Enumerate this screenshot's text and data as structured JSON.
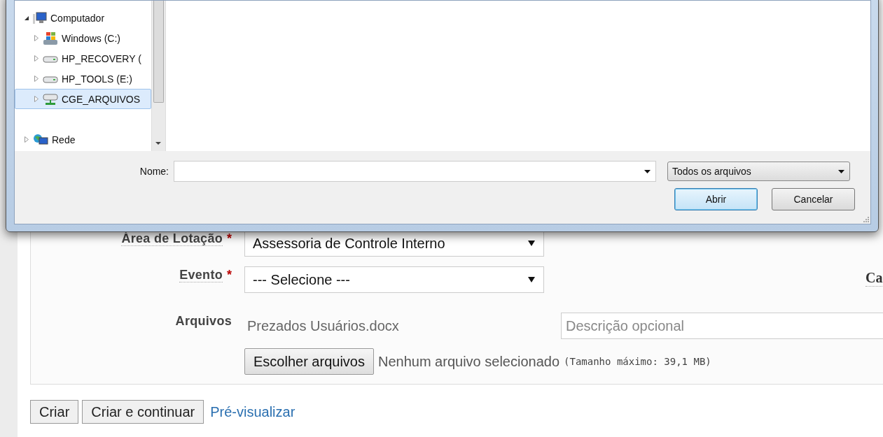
{
  "dialog": {
    "tree": [
      {
        "label": "Computador",
        "kind": "computer",
        "expanded": true,
        "selected": false,
        "children": [
          {
            "label": "Windows (C:)",
            "kind": "system-drive",
            "expanded": false,
            "selected": false
          },
          {
            "label": "HP_RECOVERY (",
            "kind": "drive",
            "expanded": false,
            "selected": false
          },
          {
            "label": "HP_TOOLS (E:)",
            "kind": "drive",
            "expanded": false,
            "selected": false
          },
          {
            "label": "CGE_ARQUIVOS",
            "kind": "network-drive",
            "expanded": false,
            "selected": true
          }
        ]
      },
      {
        "label": "Rede",
        "kind": "network",
        "expanded": false,
        "selected": false
      }
    ],
    "name_label": "Nome:",
    "file_type": "Todos os arquivos",
    "buttons": [
      {
        "label": "Abrir",
        "default": true
      },
      {
        "label": "Cancelar",
        "default": false
      }
    ]
  },
  "form": {
    "fields": [
      {
        "label": "Área de Lotação",
        "required_mark": "*",
        "kind": "select",
        "value": "Assessoria de Controle Interno"
      },
      {
        "label": "Evento",
        "required_mark": "*",
        "kind": "select",
        "value": "--- Selecione ---"
      },
      {
        "label": "Arquivos",
        "kind": "files",
        "file": "Prezados Usuários.docx",
        "description_placeholder": "Descrição opcional",
        "button": "Escolher arquivos",
        "status": "Nenhum arquivo selecionado",
        "hint": "(Tamanho máximo: 39,1 MB)"
      }
    ],
    "side_label": "Ca"
  },
  "actions": {
    "buttons": [
      "Criar",
      "Criar e continuar"
    ],
    "link": "Pré-visualizar"
  }
}
